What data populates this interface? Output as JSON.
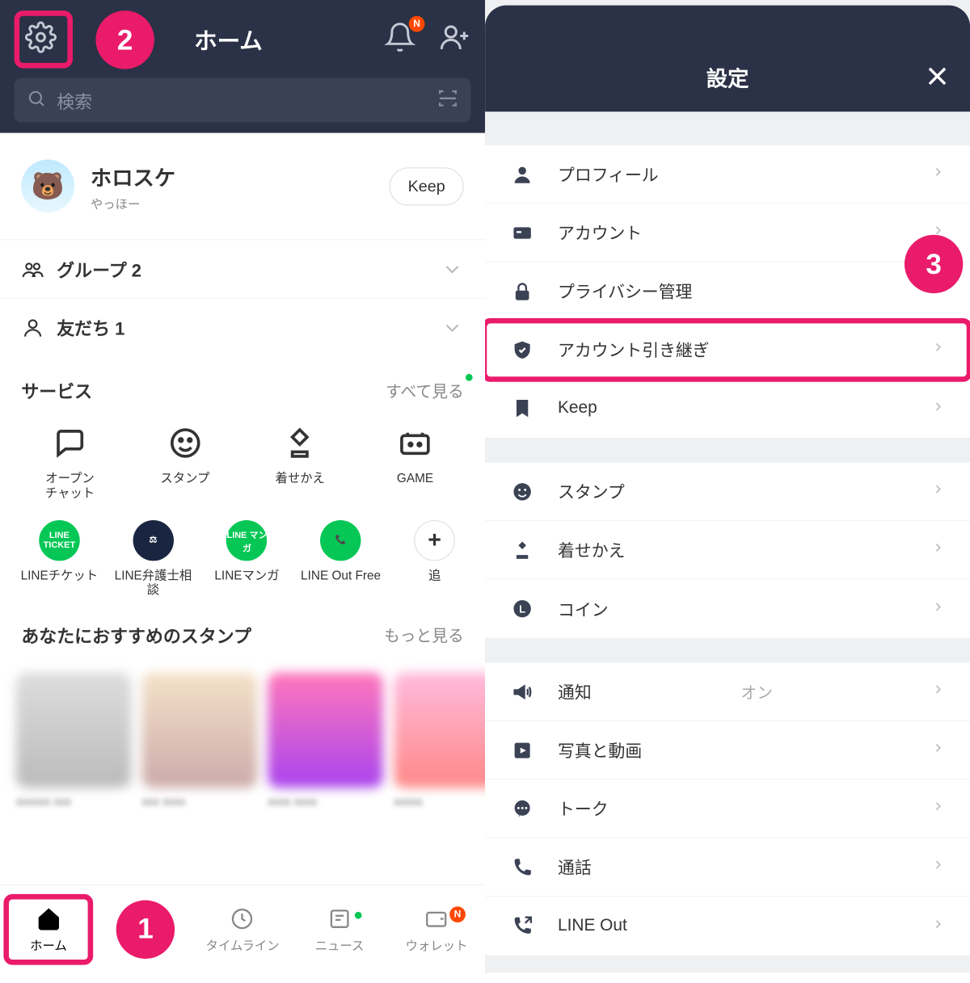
{
  "callouts": {
    "one": "1",
    "two": "2",
    "three": "3"
  },
  "left": {
    "title": "ホーム",
    "search_placeholder": "検索",
    "profile": {
      "name": "ホロスケ",
      "status": "やっほー",
      "keep": "Keep"
    },
    "groups_label": "グループ 2",
    "friends_label": "友だち 1",
    "services_title": "サービス",
    "see_all": "すべて見る",
    "services1": [
      {
        "label": "オープン\nチャット"
      },
      {
        "label": "スタンプ"
      },
      {
        "label": "着せかえ"
      },
      {
        "label": "GAME"
      }
    ],
    "services2": [
      {
        "label": "LINEチケット",
        "pill": "LINE TICKET",
        "cls": "green"
      },
      {
        "label": "LINE弁護士相談",
        "pill": "⚖",
        "cls": "navy"
      },
      {
        "label": "LINEマンガ",
        "pill": "LINE マンガ",
        "cls": "ggreen"
      },
      {
        "label": "LINE Out Free",
        "pill": "📞",
        "cls": "ggreen"
      },
      {
        "label": "追",
        "pill": "+",
        "cls": "plus"
      }
    ],
    "stamps_title": "あなたにおすすめのスタンプ",
    "more": "もっと見る",
    "tabs": [
      {
        "label": "ホーム"
      },
      {
        "label": ""
      },
      {
        "label": "タイムライン"
      },
      {
        "label": "ニュース"
      },
      {
        "label": "ウォレット"
      }
    ]
  },
  "right": {
    "title": "設定",
    "groups": [
      [
        {
          "label": "プロフィール",
          "icon": "person"
        },
        {
          "label": "アカウント",
          "icon": "idcard"
        },
        {
          "label": "プライバシー管理",
          "icon": "lock"
        },
        {
          "label": "アカウント引き継ぎ",
          "icon": "shield",
          "highlight": true
        },
        {
          "label": "Keep",
          "icon": "bookmark"
        }
      ],
      [
        {
          "label": "スタンプ",
          "icon": "smile"
        },
        {
          "label": "着せかえ",
          "icon": "brush"
        },
        {
          "label": "コイン",
          "icon": "coin"
        }
      ],
      [
        {
          "label": "通知",
          "icon": "speaker",
          "value": "オン"
        },
        {
          "label": "写真と動画",
          "icon": "play"
        },
        {
          "label": "トーク",
          "icon": "chat"
        },
        {
          "label": "通話",
          "icon": "phone"
        },
        {
          "label": "LINE Out",
          "icon": "phoneout"
        }
      ]
    ]
  }
}
